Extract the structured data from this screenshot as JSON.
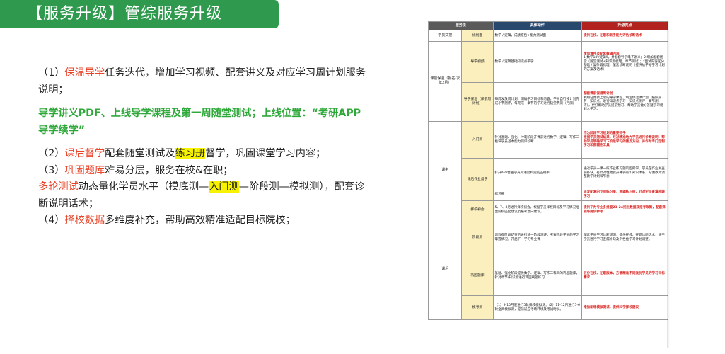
{
  "header": {
    "title": "【服务升级】管综服务升级"
  },
  "left": {
    "p1_num": "（1）",
    "p1_red": "保温导学",
    "p1_rest": "任务迭代，增加学习视频、配套讲义及对应学习周计划服务说明；",
    "p1_green": "导学讲义PDF、上线导学课程及第一周随堂测试；上线位置：“考研APP导学续学”",
    "p2_num": "（2）",
    "p2_red": "课后督学",
    "p2_a": "配套随堂测试及",
    "p2_hl": "练习册",
    "p2_b": "督学，巩固课堂学习内容；",
    "p3_num": "（3）",
    "p3_red": "巩固题库",
    "p3_rest": "难易分层，服务在校&在职；",
    "p3b_red": "多轮测试",
    "p3b_a": "动态量化学员水平（摸底测—",
    "p3b_hl": "入门测",
    "p3b_b": "—阶段测—模拟测），配套诊断说明话术；",
    "p4_num": "（4）",
    "p4_red": "择校数据",
    "p4_rest": "多维度补充，帮助高效精准适配目标院校；"
  },
  "table": {
    "headers": [
      "服务项",
      "具体动作",
      "升级亮点"
    ],
    "sections": {
      "s1": "学员交接",
      "s2": "课前保温（报名-次年2月）",
      "s3": "课中",
      "s4": "课后"
    },
    "rows": {
      "r1": {
        "sub": "规划面",
        "act": "数学 / 逻辑，成绩报告+能力测试面",
        "hi": "提供在校、在职和新手能力评估诊断话术"
      },
      "r2": {
        "sub": "导学视频",
        "act": "数学 / 逻辑基础知识点带学",
        "hi": "增加课件及配套教辅内容",
        "hi_n": "1.数学18V逻辑9，并配套导学电子讲义；2.增加配套随堂（随堂测试+知识点梳理，章节测试）；*面试内容区分基础 / 复杂再梳理，配套诊断说明（提供给学号学习计划的方案及话术）"
      },
      "r3": {
        "sub": "导学保温（课前周计划）",
        "act": "每周发放周计划，明确学习目标和内容，学员自行按计划完成小节测评，每完成一章节的学习进行随堂节测（月测）",
        "hi": "配套课前保温周计划",
        "hi_n": "利用已更新上架的导学课程，制定保温课计划（按照篇 - 节 - 知识点，进行知识点学习 - 知识点测评 - 章节测评），更好帮助学员提前预习、帮助学员做好答疑学习规划入学习。"
      },
      "r4": {
        "sub": "入门测",
        "act": "针对基础、强化、冲刺阶段开课前进行数学、逻辑、写作三板块学员基本能力测评诊断",
        "hi": "作为阶段学习规划的重要抓手",
        "hi_n": "根据学员测试结果，经过精准地为学员进行诊断说明，帮助学员明确学习下阶段学习的重点方向，并作为专门定制学习和教辅性工具"
      },
      "r5": {
        "sub": "课后作业督学",
        "act": "打开APP督查学员的进度和完成正确率",
        "hi": "",
        "hi_n": "通过学员一课一练作业练习题巩固所学，学员在作业中查漏补缺，有针对性地提升薄弱点和知识体系，方便教师调整教学计划和节奏"
      },
      "r5b": {
        "act": "练习册",
        "hi": "研发配套的专项练习册，逻辑练习册，针对学员查漏补缺学习"
      },
      "r6": {
        "sub": "择校初会",
        "act": "5、7、8月进行择校初会，根据学员择校目标及学习情况给出院校匹配建议及报考意向建议。",
        "hi": "提供了为专业多维度23-24招生数据及报考政策，配套择校等提供参考"
      },
      "r7": {
        "sub": "阶段测",
        "act": "课程每阶段结束后进行统一阶段测评，考察阶段学员的学习掌握情况，开启下一学习专业课",
        "hi": "",
        "hi_n": "配套学员学习诊断说明，提供在校、在职诊断话术，便于学员进行学习查漏补缺及个性化学习计划调整。"
      },
      "r8": {
        "sub": "巩固题库",
        "act": "基础、强化阶段提供数学、逻辑、写作三科目的巩固题库，针对章节/知识点进行巩固刷题练习",
        "hi": "区分在校、在职版本，方便精准不同类别学员的学习目标需求"
      },
      "r9": {
        "sub": "模考测",
        "act": "（1）9-10月底进行5轮择校模拟测；（2）11-12月进行5-6轮全真模拟测，提前适应考场环境及考试时长。",
        "hi": "增加新增模拟测试，提供科学择校建议"
      }
    }
  },
  "colors": {
    "banner": "#2f9a4e",
    "red": "#e8442a",
    "green": "#2fa83a",
    "highlight": "#f6f200"
  }
}
